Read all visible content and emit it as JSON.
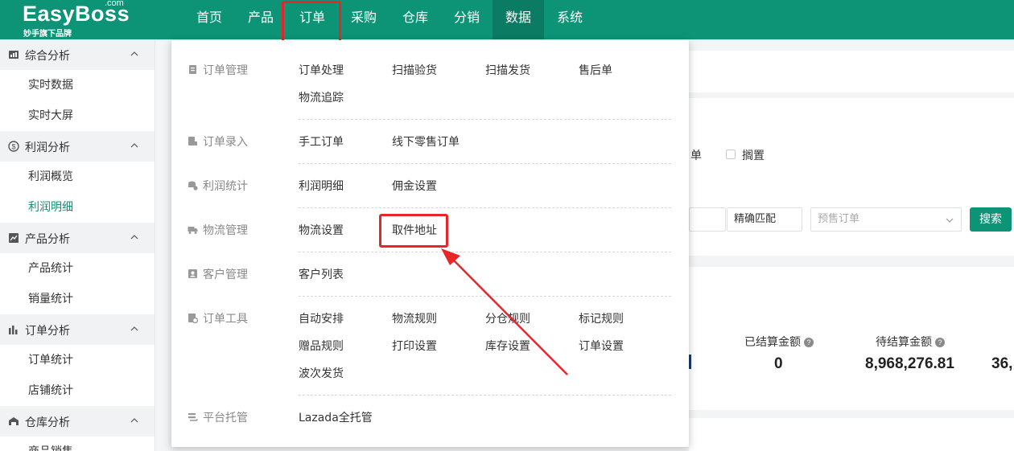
{
  "logo": {
    "brand": "EasyBoss",
    "com": ".com",
    "tagline": "妙手旗下品牌"
  },
  "nav": [
    "首页",
    "产品",
    "订单",
    "采购",
    "仓库",
    "分销",
    "数据",
    "系统"
  ],
  "sidebar": {
    "groups": [
      {
        "label": "综合分析",
        "icon": "dashboard-icon",
        "items": [
          "实时数据",
          "实时大屏"
        ]
      },
      {
        "label": "利润分析",
        "icon": "profit-icon",
        "items": [
          "利润概览",
          "利润明细"
        ]
      },
      {
        "label": "产品分析",
        "icon": "trend-icon",
        "items": [
          "产品统计",
          "销量统计"
        ]
      },
      {
        "label": "订单分析",
        "icon": "bar-chart-icon",
        "items": [
          "订单统计",
          "店铺统计"
        ]
      },
      {
        "label": "仓库分析",
        "icon": "warehouse-icon",
        "items": [
          "商品销售"
        ]
      }
    ],
    "active_item": "利润明细"
  },
  "background": {
    "filter_text_1": "单",
    "filter_text_2": "搁置",
    "exact_match": "精确匹配",
    "presale_placeholder": "预售订单",
    "search_button": "搜索",
    "stats": [
      {
        "label": "已结算金额",
        "value": "0"
      },
      {
        "label": "待结算金额",
        "value": "8,968,276.81"
      },
      {
        "label": "",
        "value": "36,"
      }
    ]
  },
  "dropdown": {
    "sections": [
      {
        "name": "订单管理",
        "icon": "document-icon",
        "links": [
          "订单处理",
          "扫描验货",
          "扫描发货",
          "售后单",
          "物流追踪"
        ]
      },
      {
        "name": "订单录入",
        "icon": "order-entry-icon",
        "links": [
          "手工订单",
          "线下零售订单"
        ]
      },
      {
        "name": "利润统计",
        "icon": "coins-icon",
        "links": [
          "利润明细",
          "佣金设置"
        ]
      },
      {
        "name": "物流管理",
        "icon": "truck-icon",
        "links": [
          "物流设置",
          "取件地址"
        ]
      },
      {
        "name": "客户管理",
        "icon": "contact-card-icon",
        "links": [
          "客户列表"
        ]
      },
      {
        "name": "订单工具",
        "icon": "tools-icon",
        "links": [
          "自动安排",
          "物流规则",
          "分仓规则",
          "标记规则",
          "赠品规则",
          "打印设置",
          "库存设置",
          "订单设置",
          "波次发货"
        ]
      },
      {
        "name": "平台托管",
        "icon": "hosting-icon",
        "links": [
          "Lazada全托管"
        ]
      }
    ]
  },
  "colors": {
    "brand": "#0d9477",
    "highlight": "#e8262a"
  }
}
